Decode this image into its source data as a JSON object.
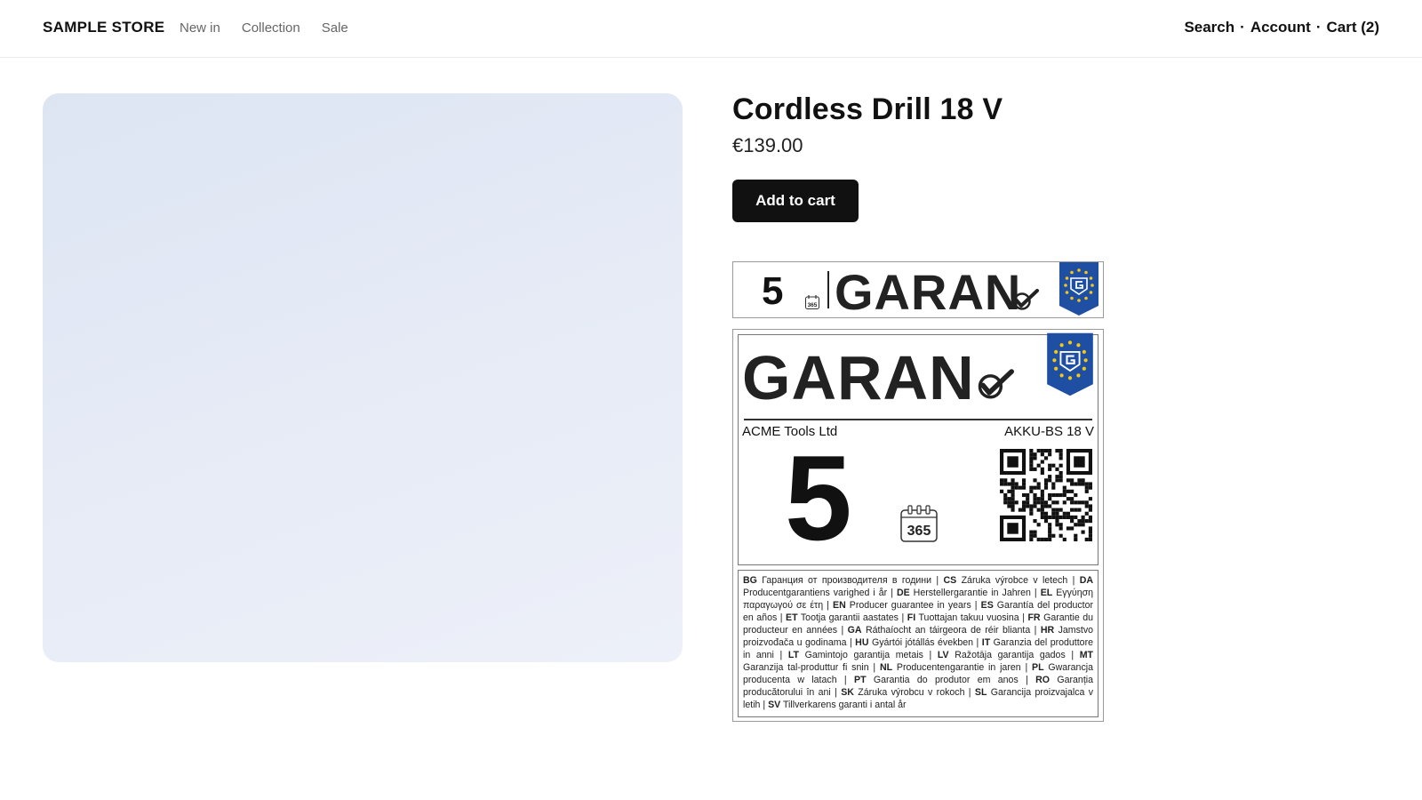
{
  "header": {
    "brand": "SAMPLE STORE",
    "nav": [
      "New in",
      "Collection",
      "Sale"
    ],
    "search_label": "Search",
    "account_label": "Account",
    "cart_label": "Cart (2)",
    "separator": "·"
  },
  "product": {
    "title": "Cordless Drill 18 V",
    "price": "€139.00",
    "add_to_cart_label": "Add to cart"
  },
  "label_small": {
    "years": "5",
    "calendar_text": "365",
    "word": "GARAN"
  },
  "label_big": {
    "word": "GARAN",
    "manufacturer": "ACME Tools Ltd",
    "model": "AKKU-BS 18 V",
    "years": "5",
    "calendar_text": "365",
    "languages": [
      {
        "code": "BG",
        "text": "Гаранция от производителя в години"
      },
      {
        "code": "CS",
        "text": "Záruka výrobce v letech"
      },
      {
        "code": "DA",
        "text": "Producentgarantiens varighed i år"
      },
      {
        "code": "DE",
        "text": "Herstellergarantie in Jahren"
      },
      {
        "code": "EL",
        "text": "Εγγύηση παραγωγού σε έτη"
      },
      {
        "code": "EN",
        "text": "Producer guarantee in years"
      },
      {
        "code": "ES",
        "text": "Garantía del productor en años"
      },
      {
        "code": "ET",
        "text": "Tootja garantii aastates"
      },
      {
        "code": "FI",
        "text": "Tuottajan takuu vuosina"
      },
      {
        "code": "FR",
        "text": "Garantie du producteur en années"
      },
      {
        "code": "GA",
        "text": "Ráthaíocht an táirgeora de réir blianta"
      },
      {
        "code": "HR",
        "text": "Jamstvo proizvođača u godinama"
      },
      {
        "code": "HU",
        "text": "Gyártói jótállás években"
      },
      {
        "code": "IT",
        "text": "Garanzia del produttore in anni"
      },
      {
        "code": "LT",
        "text": "Gamintojo garantija metais"
      },
      {
        "code": "LV",
        "text": "Ražotāja garantija gados"
      },
      {
        "code": "MT",
        "text": "Garanzija tal-produttur fi snin"
      },
      {
        "code": "NL",
        "text": "Producentengarantie in jaren"
      },
      {
        "code": "PL",
        "text": "Gwarancja producenta w latach"
      },
      {
        "code": "PT",
        "text": "Garantia do produtor em anos"
      },
      {
        "code": "RO",
        "text": "Garanția producătorului în ani"
      },
      {
        "code": "SK",
        "text": "Záruka výrobcu v rokoch"
      },
      {
        "code": "SL",
        "text": "Garancija proizvajalca v letih"
      },
      {
        "code": "SV",
        "text": "Tillverkarens garanti i antal år"
      }
    ]
  },
  "colors": {
    "eu_blue": "#1f4fa3",
    "eu_star": "#f5c518",
    "button_bg": "#111111"
  }
}
